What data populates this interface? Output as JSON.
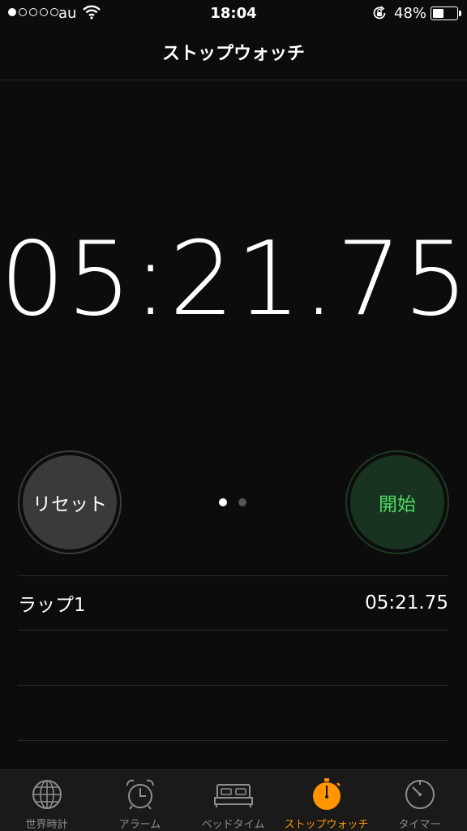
{
  "status_bar": {
    "carrier": "au",
    "time": "18:04",
    "battery_percent": "48%",
    "battery_level": 0.48,
    "signal_strength": 1
  },
  "nav": {
    "title": "ストップウォッチ"
  },
  "timer": {
    "display": "05:21.75"
  },
  "buttons": {
    "reset_label": "リセット",
    "start_label": "開始"
  },
  "page_indicator": {
    "pages": 2,
    "current": 1
  },
  "laps": [
    {
      "label": "ラップ1",
      "time": "05:21.75"
    }
  ],
  "tab_bar": {
    "tabs": [
      {
        "label": "世界時計",
        "icon": "globe-icon"
      },
      {
        "label": "アラーム",
        "icon": "alarm-clock-icon"
      },
      {
        "label": "ベッドタイム",
        "icon": "bed-icon"
      },
      {
        "label": "ストップウォッチ",
        "icon": "stopwatch-icon",
        "active": true
      },
      {
        "label": "タイマー",
        "icon": "timer-icon"
      }
    ]
  },
  "colors": {
    "accent": "#ff9500",
    "start_green": "#4cd964",
    "background": "#0c0c0c"
  }
}
